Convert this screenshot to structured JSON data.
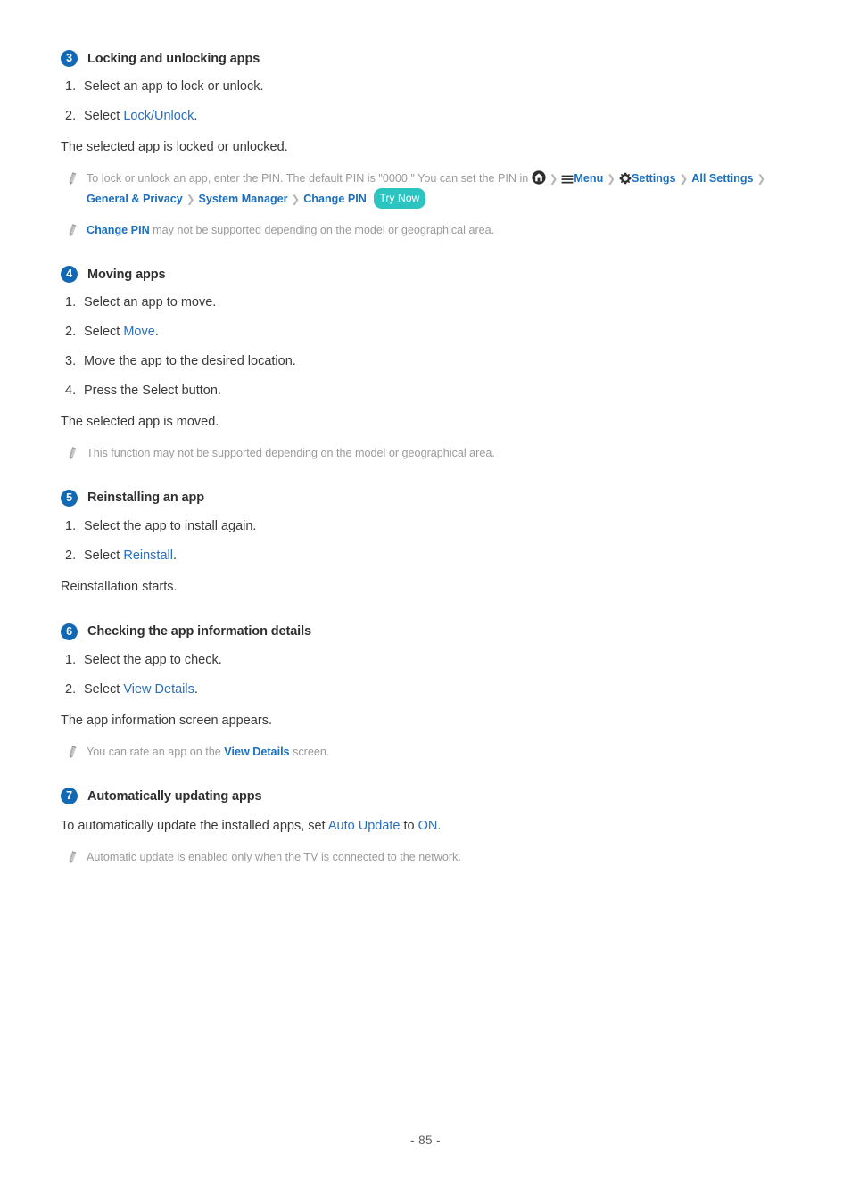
{
  "page": {
    "number_label": "- 85 -"
  },
  "icons": {
    "note_bullet": "pencil-icon",
    "home": "home-icon",
    "menu": "hamburger-menu-icon",
    "settings": "gear-icon",
    "chevron": "chevron-right-icon"
  },
  "colors": {
    "badge_blue": "#1268b3",
    "link_blue": "#2a6fbe",
    "link_bold_blue": "#1b6fc0",
    "note_gray": "#9a9a9a",
    "body_gray": "#3a3a3a",
    "trynow_teal": "#2bc4c0",
    "chevron_gray": "#b6b6b6"
  },
  "sections": [
    {
      "badge": "3",
      "title": "Locking and unlocking apps",
      "steps": [
        {
          "num": "1.",
          "text": "Select an app to lock or unlock."
        },
        {
          "num": "2.",
          "pre": "Select ",
          "link": "Lock/Unlock",
          "post": "."
        }
      ],
      "result": "The selected app is locked or unlocked.",
      "notes": [
        {
          "lead": "To lock or unlock an app, enter the PIN. The default PIN is \"0000.\" You can set the PIN in ",
          "breadcrumb": [
            {
              "type": "icon",
              "name": "home-icon"
            },
            {
              "type": "icon-label",
              "name": "hamburger-menu-icon",
              "label": "Menu"
            },
            {
              "type": "icon-label",
              "name": "gear-icon",
              "label": "Settings"
            },
            {
              "type": "label",
              "label": "All Settings"
            },
            {
              "type": "label",
              "label": "General & Privacy"
            },
            {
              "type": "label",
              "label": "System Manager"
            },
            {
              "type": "label",
              "label": "Change PIN"
            }
          ],
          "tail": ".",
          "try_now": "Try Now"
        },
        {
          "bold_link": "Change PIN",
          "text": " may not be supported depending on the model or geographical area."
        }
      ]
    },
    {
      "badge": "4",
      "title": "Moving apps",
      "steps": [
        {
          "num": "1.",
          "text": "Select an app to move."
        },
        {
          "num": "2.",
          "pre": "Select ",
          "link": "Move",
          "post": "."
        },
        {
          "num": "3.",
          "text": "Move the app to the desired location."
        },
        {
          "num": "4.",
          "text": "Press the Select button."
        }
      ],
      "result": "The selected app is moved.",
      "notes": [
        {
          "text": "This function may not be supported depending on the model or geographical area."
        }
      ]
    },
    {
      "badge": "5",
      "title": "Reinstalling an app",
      "steps": [
        {
          "num": "1.",
          "text": "Select the app to install again."
        },
        {
          "num": "2.",
          "pre": "Select ",
          "link": "Reinstall",
          "post": "."
        }
      ],
      "result": "Reinstallation starts.",
      "notes": []
    },
    {
      "badge": "6",
      "title": "Checking the app information details",
      "steps": [
        {
          "num": "1.",
          "text": "Select the app to check."
        },
        {
          "num": "2.",
          "pre": "Select ",
          "link": "View Details",
          "post": "."
        }
      ],
      "result": "The app information screen appears.",
      "notes": [
        {
          "pre": "You can rate an app on the ",
          "bold_link": "View Details",
          "post": " screen."
        }
      ]
    },
    {
      "badge": "7",
      "title": "Automatically updating apps",
      "steps": [],
      "body": {
        "pre": "To automatically update the installed apps, set ",
        "link1": "Auto Update",
        "mid": " to ",
        "link2": "ON",
        "post": "."
      },
      "notes": [
        {
          "text": "Automatic update is enabled only when the TV is connected to the network."
        }
      ]
    }
  ]
}
